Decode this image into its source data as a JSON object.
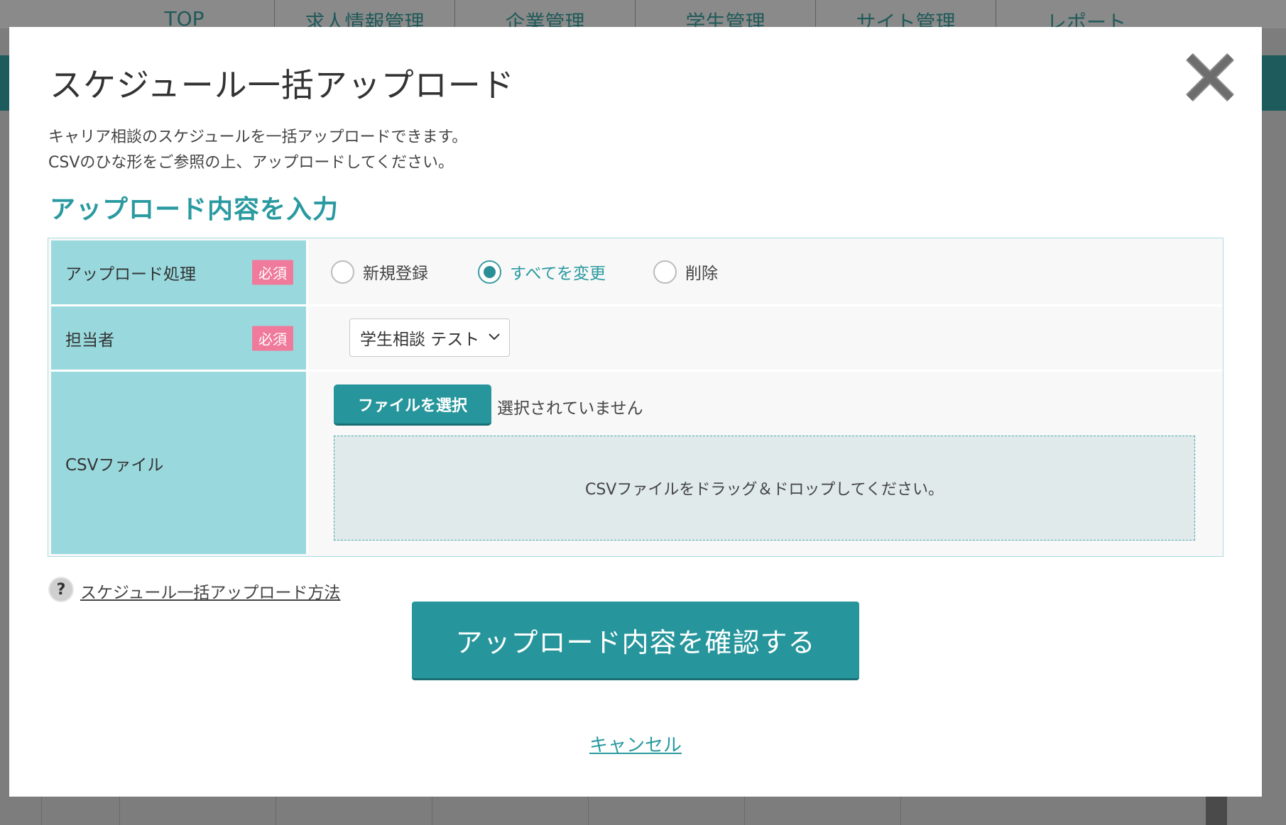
{
  "background": {
    "nav": [
      "TOP",
      "求人情報管理",
      "企業管理",
      "学生管理",
      "サイト管理",
      "レポート"
    ]
  },
  "modal": {
    "title": "スケジュール一括アップロード",
    "description": [
      "キャリア相談のスケジュールを一括アップロードできます。",
      "CSVのひな形をご参照の上、アップロードしてください。"
    ],
    "section_title": "アップロード内容を入力",
    "form": {
      "upload_process": {
        "label": "アップロード処理",
        "required": "必須",
        "options": [
          "新規登録",
          "すべてを変更",
          "削除"
        ],
        "selected": "すべてを変更"
      },
      "person_in_charge": {
        "label": "担当者",
        "required": "必須",
        "selected": "学生相談 テスト"
      },
      "csv_file": {
        "label": "CSVファイル",
        "button": "ファイルを選択",
        "status": "選択されていません",
        "drop_hint": "CSVファイルをドラッグ＆ドロップしてください。"
      }
    },
    "help_link": "スケジュール一括アップロード方法",
    "confirm_button": "アップロード内容を確認する",
    "cancel_link": "キャンセル"
  },
  "colors": {
    "accent": "#26969c",
    "label_bg": "#99d9de",
    "required_badge": "#f07a9b"
  }
}
